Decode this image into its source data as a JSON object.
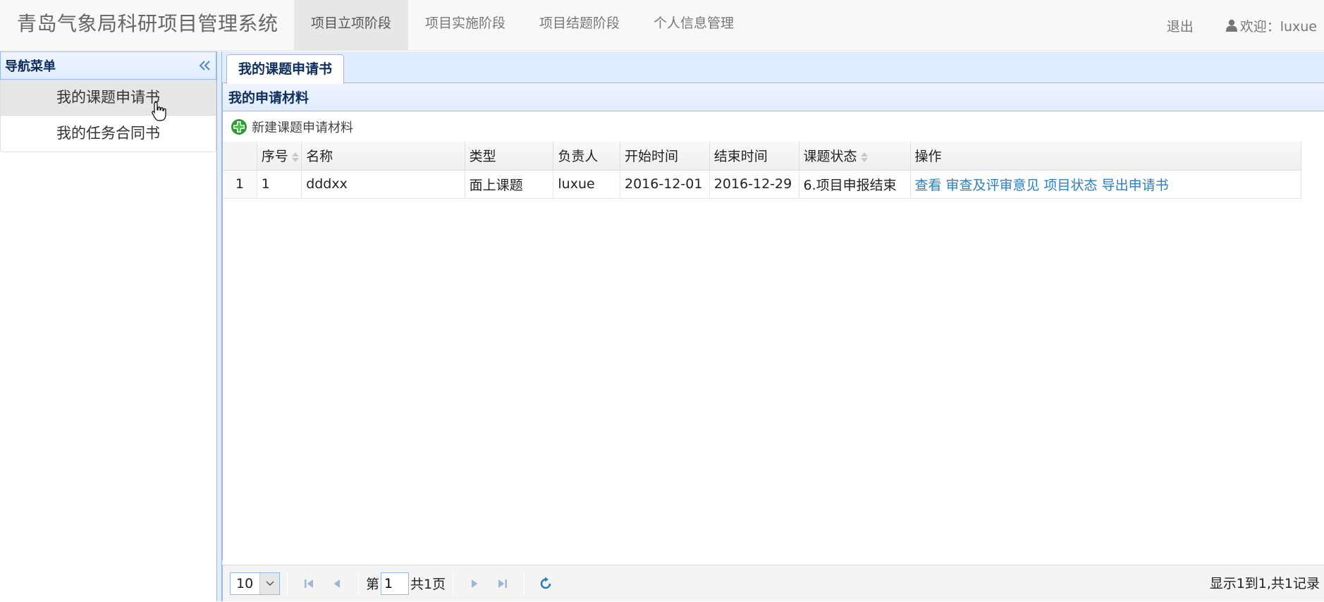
{
  "app": {
    "brand": "青岛气象局科研项目管理系统"
  },
  "topnav": {
    "tabs": [
      {
        "label": "项目立项阶段"
      },
      {
        "label": "项目实施阶段"
      },
      {
        "label": "项目结题阶段"
      },
      {
        "label": "个人信息管理"
      }
    ],
    "logout": "退出",
    "welcome": "欢迎：luxue"
  },
  "sidebar": {
    "title": "导航菜单",
    "items": [
      {
        "label": "我的课题申请书"
      },
      {
        "label": "我的任务合同书"
      }
    ]
  },
  "main": {
    "tab": "我的课题申请书",
    "panel_title": "我的申请材料",
    "toolbar": {
      "new_label": "新建课题申请材料"
    },
    "grid": {
      "columns": [
        "序号",
        "名称",
        "类型",
        "负责人",
        "开始时间",
        "结束时间",
        "课题状态",
        "操作"
      ],
      "rows": [
        {
          "rownum": "1",
          "seq": "1",
          "name": "dddxx",
          "type": "面上课题",
          "owner": "luxue",
          "start": "2016-12-01",
          "end": "2016-12-29",
          "status": "6.项目申报结束",
          "actions": [
            "查看",
            "审查及评审意见",
            "项目状态",
            "导出申请书"
          ]
        }
      ]
    },
    "pager": {
      "page_size": "10",
      "page_prefix": "第",
      "page_value": "1",
      "page_suffix": "共1页",
      "info": "显示1到1,共1记录"
    }
  },
  "colors": {
    "accent_border": "#95b8e7",
    "header_text": "#0e2d5f",
    "link": "#2a7fc4",
    "add_icon": "#2e9b2e"
  }
}
